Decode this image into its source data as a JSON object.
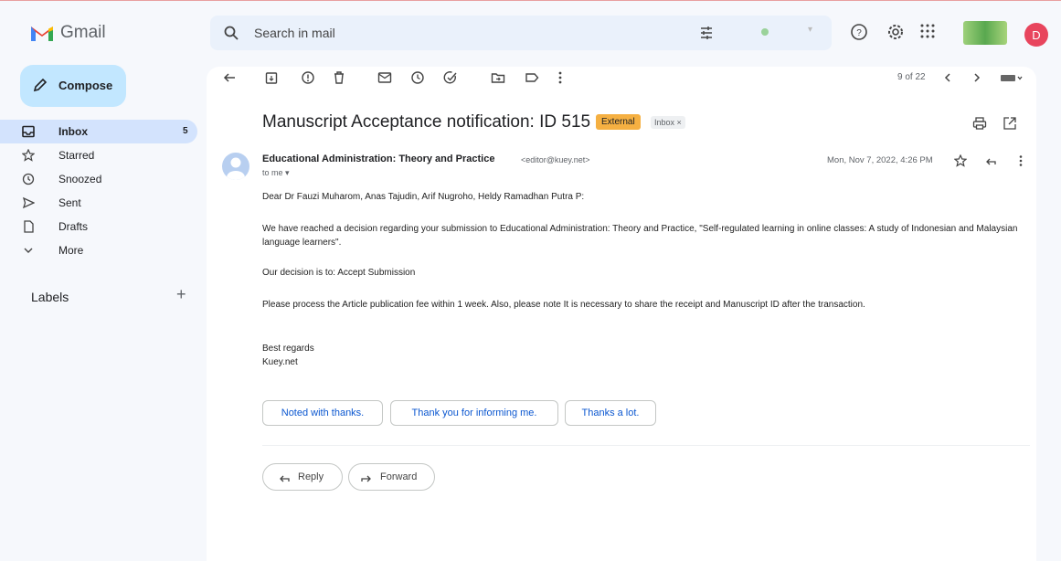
{
  "app": {
    "name": "Gmail",
    "brand_colors": {
      "red": "#EA4335",
      "blue": "#4285F4",
      "green": "#34A853",
      "yellow": "#FBBC04"
    }
  },
  "search": {
    "placeholder": "Search in mail",
    "icon": "search-icon",
    "filter_icon": "tune-icon"
  },
  "header_icons": [
    "help-icon",
    "settings-icon",
    "apps-grid-icon"
  ],
  "account": {
    "avatar_letter": "D",
    "avatar_color": "#E8455D"
  },
  "compose": {
    "label": "Compose"
  },
  "sidebar": {
    "items": [
      {
        "label": "Inbox",
        "count": "5",
        "icon": "inbox-icon",
        "active": true
      },
      {
        "label": "Starred",
        "icon": "star-icon"
      },
      {
        "label": "Snoozed",
        "icon": "clock-icon"
      },
      {
        "label": "Sent",
        "icon": "send-icon"
      },
      {
        "label": "Drafts",
        "icon": "draft-icon"
      },
      {
        "label": "More",
        "icon": "chevron-down-icon"
      }
    ],
    "labels_heading": "Labels",
    "labels_add": "+"
  },
  "toolbar": {
    "icons": [
      "back-arrow-icon",
      "archive-icon",
      "report-spam-icon",
      "delete-icon",
      "mark-unread-icon",
      "snooze-icon",
      "add-task-icon",
      "move-to-icon",
      "label-icon",
      "more-vert-icon"
    ],
    "pager": "9 of 22"
  },
  "email": {
    "subject": "Manuscript Acceptance notification: ID 515",
    "tags": [
      "External",
      "Inbox ×"
    ],
    "tag_colors": {
      "external": "#F5B042"
    },
    "sender_name": "Educational Administration: Theory and Practice",
    "sender_email": "<editor@kuey.net>",
    "to": "to me ▾",
    "date": "Mon, Nov 7, 2022, 4:26 PM",
    "body": {
      "greeting": "Dear Dr Fauzi Muharom, Anas Tajudin, Arif Nugroho, Heldy Ramadhan Putra P:",
      "p1": "We have reached a decision regarding your submission to Educational Administration: Theory and Practice, \"Self-regulated learning in online classes: A study of Indonesian and Malaysian language learners\".",
      "decision": "Our decision is to: Accept Submission",
      "p2": "Please process the Article publication fee within 1 week. Also, please note It is necessary to share the receipt and Manuscript ID after the transaction.",
      "signoff": "Best regards",
      "signature": "Kuey.net"
    }
  },
  "smart_replies": [
    "Noted with thanks.",
    "Thank you for informing me.",
    "Thanks a lot."
  ],
  "actions": {
    "reply": "Reply",
    "forward": "Forward"
  }
}
